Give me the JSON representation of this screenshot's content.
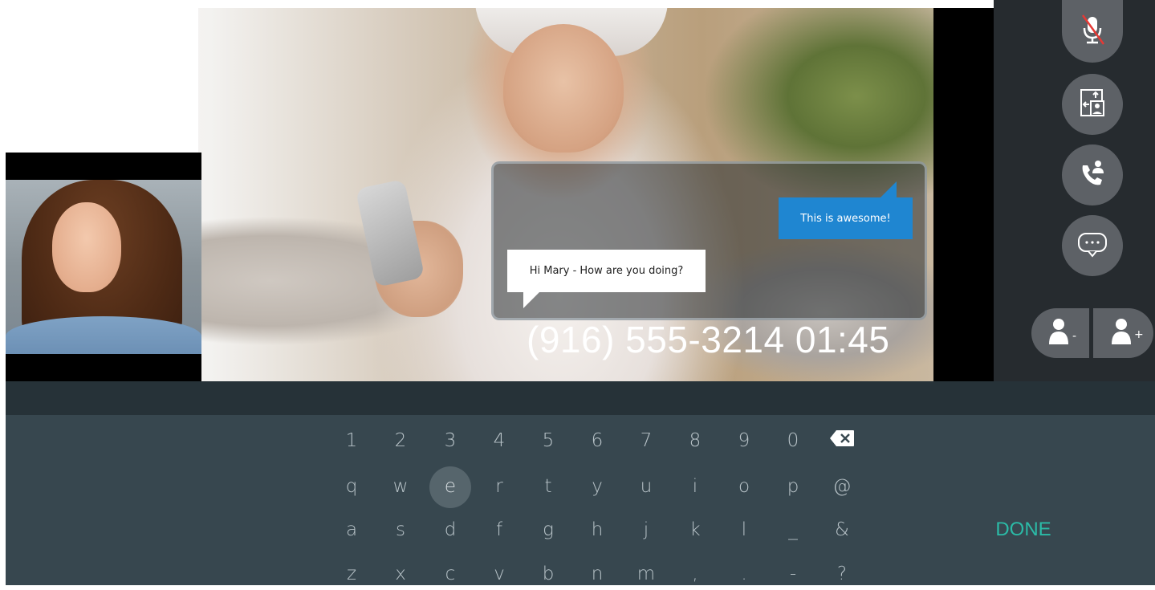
{
  "chat": {
    "outgoing_message": "This is awesome!",
    "incoming_message": "Hi Mary - How are you doing?"
  },
  "call": {
    "phone_number": "(916) 555-3214",
    "duration": "01:45"
  },
  "controls": {
    "icons": [
      "microphone-muted-icon",
      "screen-share-icon",
      "call-transfer-icon",
      "chat-bubble-icon",
      "remove-participant-icon",
      "add-participant-icon"
    ],
    "remove_participant_symbol": "-",
    "add_participant_symbol": "+"
  },
  "keyboard": {
    "row1": [
      "1",
      "2",
      "3",
      "4",
      "5",
      "6",
      "7",
      "8",
      "9",
      "0"
    ],
    "row2": [
      "q",
      "w",
      "e",
      "r",
      "t",
      "y",
      "u",
      "i",
      "o",
      "p",
      "@"
    ],
    "row3": [
      "a",
      "s",
      "d",
      "f",
      "g",
      "h",
      "j",
      "k",
      "l",
      "_",
      "&"
    ],
    "row4": [
      "z",
      "x",
      "c",
      "v",
      "b",
      "n",
      "m",
      ",",
      ".",
      "-",
      "?"
    ],
    "active_key": "e",
    "done_label": "DONE"
  },
  "colors": {
    "chat_outgoing": "#1f86d1",
    "done_accent": "#2bbba7",
    "keyboard_bg": "#37474f"
  }
}
